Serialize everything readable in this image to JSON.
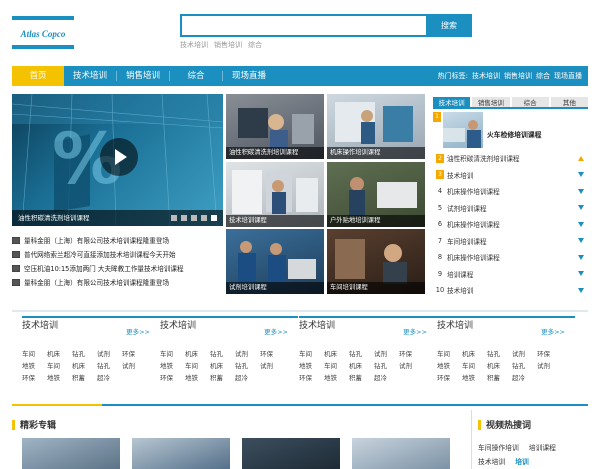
{
  "header": {
    "logo_text": "Atlas Copco",
    "search_placeholder": "",
    "search_button": "搜索",
    "search_tags": [
      "技术培训",
      "销售培训",
      "综合"
    ]
  },
  "nav": {
    "items": [
      "首页",
      "技术培训",
      "销售培训",
      "综合",
      "现场直播"
    ],
    "hot_label": "热门标签:",
    "hot_tags": [
      "技术培训",
      "销售培训",
      "综合",
      "现场直播"
    ]
  },
  "featured": {
    "caption": "油性积碳清洗剂培训课程"
  },
  "news": [
    "量科金朋（上海）有限公司技术培训课程隆重登场",
    "普代网络索兰超冷可直接添加技术培训课程今天开始",
    "空压机油10:15添加两门  大夫眸教工作量技术培训课程",
    "量科金朋（上海）有限公司技术培训课程隆重登场"
  ],
  "thumbs": [
    "油性积碳清洗剂培训课程",
    "机床操作培训课程",
    "技术培训课程",
    "户外贴地培训课程",
    "试剂培训课程",
    "车间培训课程"
  ],
  "ranking": {
    "tabs": [
      "技术培训",
      "销售培训",
      "综合",
      "其他"
    ],
    "top": {
      "num": "1",
      "title": "火车检修培训课程"
    },
    "items": [
      {
        "num": "2",
        "label": "油性积碳清洗剂培训课程",
        "trend": "up"
      },
      {
        "num": "3",
        "label": "技术培训",
        "trend": "down"
      },
      {
        "num": "4",
        "label": "机床操作培训课程",
        "trend": "down"
      },
      {
        "num": "5",
        "label": "试剂培训课程",
        "trend": "down"
      },
      {
        "num": "6",
        "label": "机床操作培训课程",
        "trend": "down"
      },
      {
        "num": "7",
        "label": "车间培训课程",
        "trend": "down"
      },
      {
        "num": "8",
        "label": "机床操作培训课程",
        "trend": "down"
      },
      {
        "num": "9",
        "label": "培训课程",
        "trend": "down"
      },
      {
        "num": "10",
        "label": "技术培训",
        "trend": "down"
      }
    ]
  },
  "categories": [
    {
      "title": "技术培训",
      "more": "更多>>",
      "links": [
        "车间",
        "机床",
        "钻孔",
        "试剂",
        "环保",
        "地铁",
        "车间",
        "机床",
        "钻孔",
        "试剂",
        "环保",
        "地铁",
        "积蓄",
        "超冷"
      ]
    },
    {
      "title": "技术培训",
      "more": "更多>>",
      "links": [
        "车间",
        "机床",
        "钻孔",
        "试剂",
        "环保",
        "地铁",
        "车间",
        "机床",
        "钻孔",
        "试剂",
        "环保",
        "地铁",
        "积蓄",
        "超冷"
      ]
    },
    {
      "title": "技术培训",
      "more": "更多>>",
      "links": [
        "车间",
        "机床",
        "钻孔",
        "试剂",
        "环保",
        "地铁",
        "车间",
        "机床",
        "钻孔",
        "试剂",
        "环保",
        "地铁",
        "积蓄",
        "超冷"
      ]
    },
    {
      "title": "技术培训",
      "more": "更多>>",
      "links": [
        "车间",
        "机床",
        "钻孔",
        "试剂",
        "环保",
        "地铁",
        "车间",
        "机床",
        "钻孔",
        "试剂",
        "环保",
        "地铁",
        "积蓄",
        "超冷"
      ]
    }
  ],
  "special": {
    "title": "精彩专辑"
  },
  "video_hot": {
    "title": "视频热搜词",
    "rows": [
      [
        "车间操作培训",
        "培训课程"
      ],
      [
        "技术培训",
        "培训"
      ]
    ]
  }
}
